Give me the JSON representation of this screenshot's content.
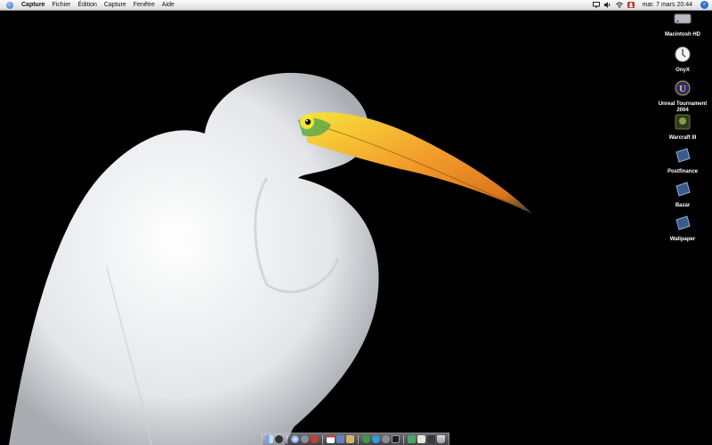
{
  "menubar": {
    "items": [
      "Capture",
      "Fichier",
      "Édition",
      "Capture",
      "Fenêtre",
      "Aide"
    ],
    "clock": "mar. 7 mars 20:44",
    "status_icons": [
      "display-icon",
      "volume-icon",
      "airport-icon",
      "user-icon",
      "spotlight-icon"
    ]
  },
  "desktop": {
    "icons": [
      {
        "label": "Macintosh HD",
        "icon": "hard-disk-icon"
      },
      {
        "label": "OnyX",
        "icon": "onyx-app-icon"
      },
      {
        "label": "Unreal Tournament 2004",
        "icon": "unreal-tournament-icon"
      },
      {
        "label": "Warcraft III",
        "icon": "warcraft-icon"
      },
      {
        "label": "Postfinance",
        "icon": "document-icon"
      },
      {
        "label": "Bazar",
        "icon": "document-icon"
      },
      {
        "label": "Wallpaper",
        "icon": "document-icon"
      }
    ]
  },
  "dock": {
    "apps": [
      "finder-icon",
      "dashboard-icon",
      "safari-icon",
      "firefox-icon",
      "mail-icon",
      "ical-icon",
      "itunes-icon",
      "iphoto-icon",
      "ichat-icon",
      "skype-icon",
      "system-preferences-icon",
      "terminal-icon",
      "preview-icon",
      "textedit-icon",
      "activity-monitor-icon",
      "trash-icon"
    ]
  }
}
